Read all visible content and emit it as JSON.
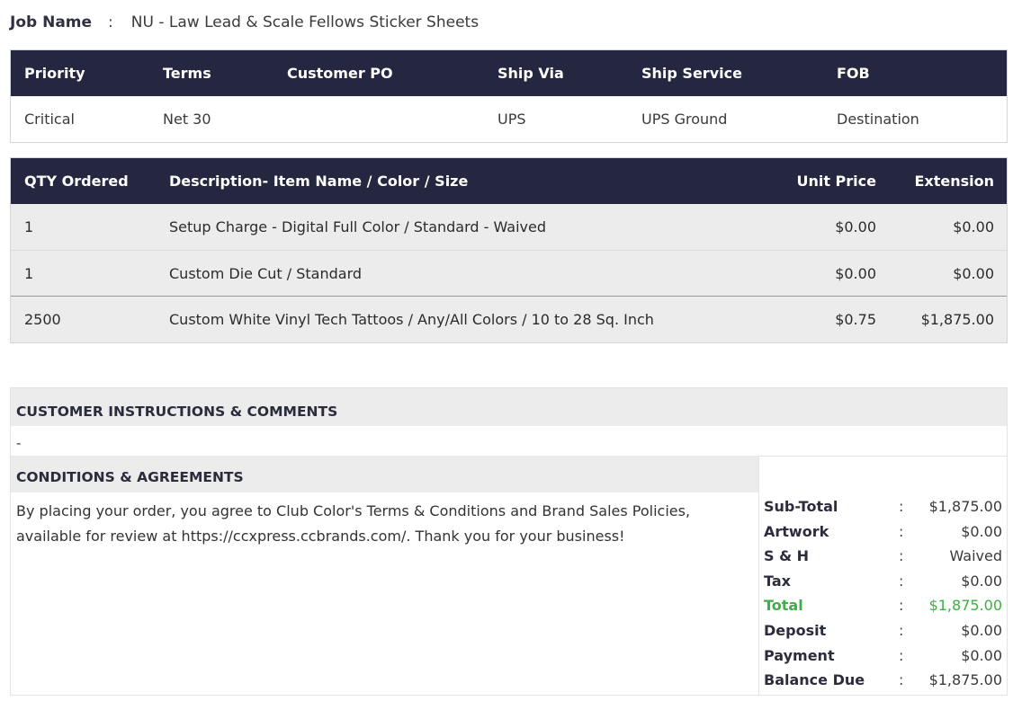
{
  "job": {
    "label": "Job Name",
    "separator": ":",
    "value": "NU - Law Lead & Scale Fellows Sticker Sheets"
  },
  "order_info": {
    "headers": [
      "Priority",
      "Terms",
      "Customer PO",
      "Ship Via",
      "Ship Service",
      "FOB"
    ],
    "values": [
      "Critical",
      "Net 30",
      "",
      "UPS",
      "UPS Ground",
      "Destination"
    ]
  },
  "items": {
    "headers": {
      "qty": "QTY Ordered",
      "desc": "Description- Item Name / Color / Size",
      "unit": "Unit Price",
      "ext": "Extension"
    },
    "rows": [
      {
        "qty": "1",
        "desc": "Setup Charge - Digital Full Color / Standard - Waived",
        "unit": "$0.00",
        "ext": "$0.00"
      },
      {
        "qty": "1",
        "desc": "Custom Die Cut / Standard",
        "unit": "$0.00",
        "ext": "$0.00"
      },
      {
        "qty": "2500",
        "desc": "Custom White Vinyl Tech Tattoos / Any/All Colors / 10 to 28 Sq. Inch",
        "unit": "$0.75",
        "ext": "$1,875.00"
      }
    ]
  },
  "instructions": {
    "title": "CUSTOMER INSTRUCTIONS & COMMENTS",
    "text": "-"
  },
  "conditions": {
    "title": "CONDITIONS & AGREEMENTS",
    "text": "By placing your order, you agree to Club Color's Terms & Conditions and Brand Sales Policies, available for review at https://ccxpress.ccbrands.com/. Thank you for your business!"
  },
  "totals": {
    "separator": ":",
    "rows": [
      {
        "label": "Sub-Total",
        "value": "$1,875.00"
      },
      {
        "label": "Artwork",
        "value": "$0.00"
      },
      {
        "label": "S & H",
        "value": "Waived"
      },
      {
        "label": "Tax",
        "value": "$0.00"
      },
      {
        "label": "Total",
        "value": "$1,875.00"
      },
      {
        "label": "Deposit",
        "value": "$0.00"
      },
      {
        "label": "Payment",
        "value": "$0.00"
      },
      {
        "label": "Balance Due",
        "value": "$1,875.00"
      }
    ]
  },
  "colors": {
    "header_bg": "#25263f",
    "total_green": "#3cb043",
    "row_bg": "#ececec"
  }
}
